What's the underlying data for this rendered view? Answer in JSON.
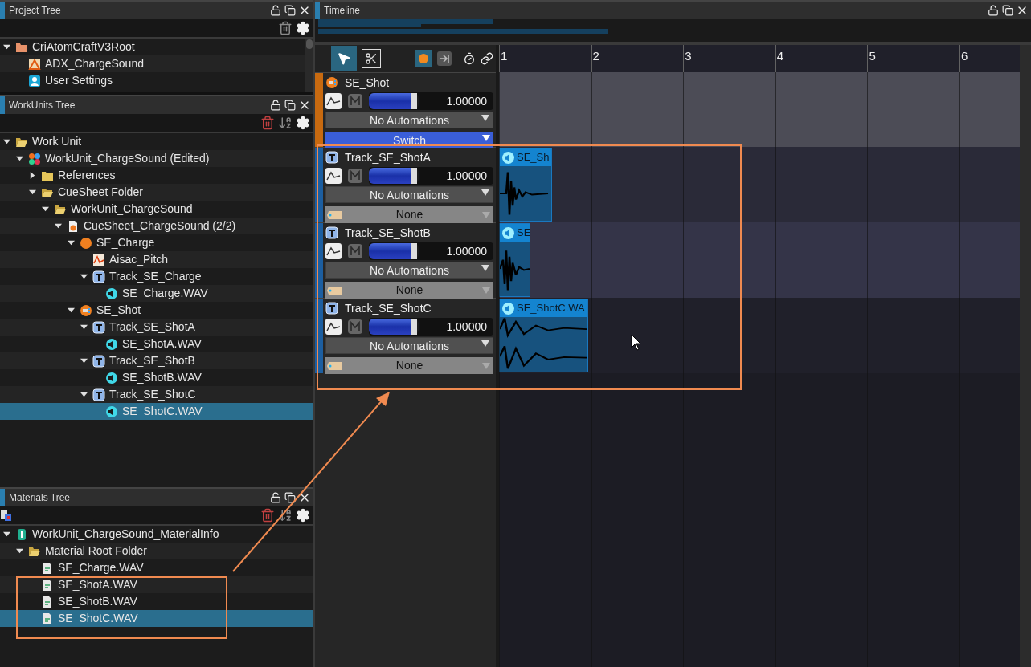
{
  "project_tree": {
    "title": "Project Tree",
    "items": [
      {
        "label": "CriAtomCraftV3Root",
        "kind": "root-folder",
        "expanded": true,
        "selected": false,
        "children": [
          {
            "label": "ADX_ChargeSound",
            "kind": "adx",
            "selected": false
          },
          {
            "label": "User Settings",
            "kind": "user",
            "selected": false
          }
        ]
      }
    ]
  },
  "workunits_tree": {
    "title": "WorkUnits Tree",
    "items": [
      {
        "label": "Work Unit",
        "kind": "folder-open",
        "expanded": true,
        "selected": false,
        "children": [
          {
            "label": "WorkUnit_ChargeSound (Edited)",
            "kind": "workunit",
            "expanded": true,
            "selected": false,
            "children": [
              {
                "label": "References",
                "kind": "folder",
                "expanded": false,
                "selected": false
              },
              {
                "label": "CueSheet Folder",
                "kind": "folder-open",
                "expanded": true,
                "selected": false,
                "children": [
                  {
                    "label": "WorkUnit_ChargeSound",
                    "kind": "folder-open",
                    "expanded": true,
                    "selected": false,
                    "children": [
                      {
                        "label": "CueSheet_ChargeSound (2/2)",
                        "kind": "cuesheet",
                        "expanded": true,
                        "selected": false,
                        "children": [
                          {
                            "label": "SE_Charge",
                            "kind": "cue",
                            "expanded": true,
                            "selected": false,
                            "children": [
                              {
                                "label": "Aisac_Pitch",
                                "kind": "aisac",
                                "selected": false
                              },
                              {
                                "label": "Track_SE_Charge",
                                "kind": "track",
                                "expanded": true,
                                "selected": false,
                                "children": [
                                  {
                                    "label": "SE_Charge.WAV",
                                    "kind": "wave",
                                    "selected": false
                                  }
                                ]
                              }
                            ]
                          },
                          {
                            "label": "SE_Shot",
                            "kind": "switch-cue",
                            "expanded": true,
                            "selected": false,
                            "children": [
                              {
                                "label": "Track_SE_ShotA",
                                "kind": "track",
                                "expanded": true,
                                "selected": false,
                                "children": [
                                  {
                                    "label": "SE_ShotA.WAV",
                                    "kind": "wave",
                                    "selected": false
                                  }
                                ]
                              },
                              {
                                "label": "Track_SE_ShotB",
                                "kind": "track",
                                "expanded": true,
                                "selected": false,
                                "children": [
                                  {
                                    "label": "SE_ShotB.WAV",
                                    "kind": "wave",
                                    "selected": false
                                  }
                                ]
                              },
                              {
                                "label": "Track_SE_ShotC",
                                "kind": "track",
                                "expanded": true,
                                "selected": false,
                                "children": [
                                  {
                                    "label": "SE_ShotC.WAV",
                                    "kind": "wave",
                                    "selected": true
                                  }
                                ]
                              }
                            ]
                          }
                        ]
                      }
                    ]
                  }
                ]
              }
            ]
          }
        ]
      }
    ]
  },
  "materials_tree": {
    "title": "Materials Tree",
    "items": [
      {
        "label": "WorkUnit_ChargeSound_MaterialInfo",
        "kind": "material-info",
        "expanded": true,
        "selected": false,
        "children": [
          {
            "label": "Material Root Folder",
            "kind": "folder-open",
            "expanded": true,
            "selected": false,
            "children": [
              {
                "label": "SE_Charge.WAV",
                "kind": "material",
                "selected": false
              },
              {
                "label": "SE_ShotA.WAV",
                "kind": "material",
                "selected": false
              },
              {
                "label": "SE_ShotB.WAV",
                "kind": "material",
                "selected": false
              },
              {
                "label": "SE_ShotC.WAV",
                "kind": "material",
                "selected": true
              }
            ]
          }
        ]
      }
    ]
  },
  "timeline": {
    "title": "Timeline",
    "ruler": [
      "1",
      "2",
      "3",
      "4",
      "5",
      "6"
    ],
    "cue": {
      "name": "SE_Shot",
      "volume": "1.00000",
      "level": 0.85,
      "automation": "No Automations",
      "selector": "Switch"
    },
    "tracks": [
      {
        "name": "Track_SE_ShotA",
        "volume": "1.00000",
        "level": 0.85,
        "automation": "No Automations",
        "selector": "None",
        "clip": "SE_Sh"
      },
      {
        "name": "Track_SE_ShotB",
        "volume": "1.00000",
        "level": 0.85,
        "automation": "No Automations",
        "selector": "None",
        "clip": "SE"
      },
      {
        "name": "Track_SE_ShotC",
        "volume": "1.00000",
        "level": 0.85,
        "automation": "No Automations",
        "selector": "None",
        "clip": "SE_ShotC.WA"
      }
    ]
  }
}
